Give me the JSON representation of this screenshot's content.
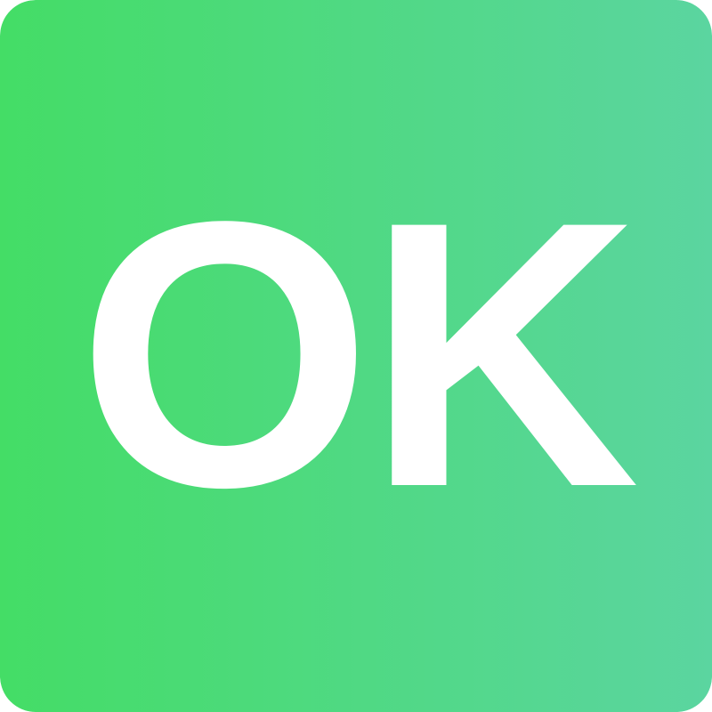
{
  "badge": {
    "text": "OK",
    "text_color": "#ffffff",
    "gradient_start": "#44dd66",
    "gradient_end": "#5bd5a0"
  }
}
